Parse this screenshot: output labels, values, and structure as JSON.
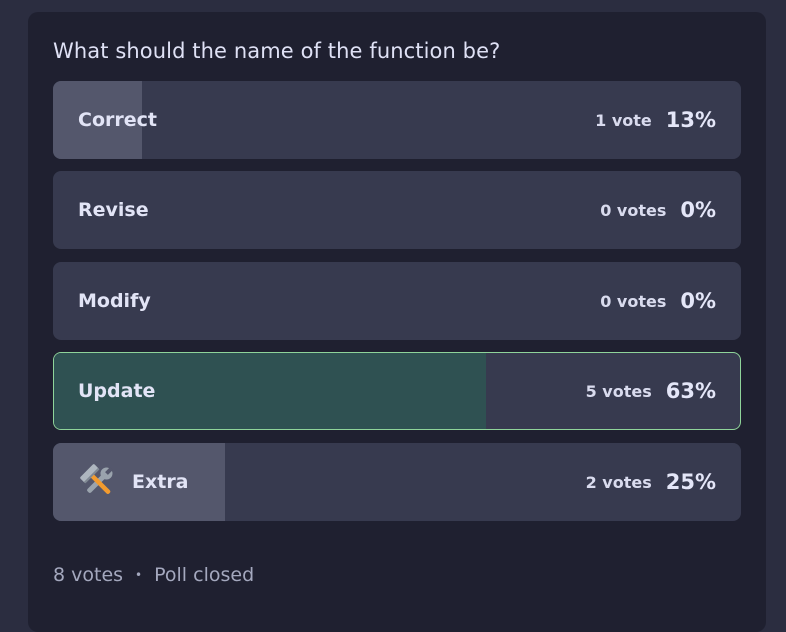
{
  "poll": {
    "question": "What should the name of the function be?",
    "options": [
      {
        "label": "Correct",
        "votes_text": "1 vote",
        "percent_text": "13%",
        "fraction": 0.13,
        "winner": false
      },
      {
        "label": "Revise",
        "votes_text": "0 votes",
        "percent_text": "0%",
        "fraction": 0.0,
        "winner": false
      },
      {
        "label": "Modify",
        "votes_text": "0 votes",
        "percent_text": "0%",
        "fraction": 0.0,
        "winner": false
      },
      {
        "label": "Update",
        "votes_text": "5 votes",
        "percent_text": "63%",
        "fraction": 0.63,
        "winner": true
      },
      {
        "label": "Extra",
        "votes_text": "2 votes",
        "percent_text": "25%",
        "fraction": 0.25,
        "winner": false,
        "icon": "hammer-and-wrench-icon"
      }
    ],
    "footer": {
      "total_votes": "8 votes",
      "separator": "•",
      "status": "Poll closed"
    }
  },
  "colors": {
    "page_background": "#2b2d40",
    "card_background": "#1f2030",
    "option_background": "#373a4f",
    "option_fill": "#54576c",
    "winner_fill": "#2f5152",
    "winner_border": "#8fd49a"
  }
}
